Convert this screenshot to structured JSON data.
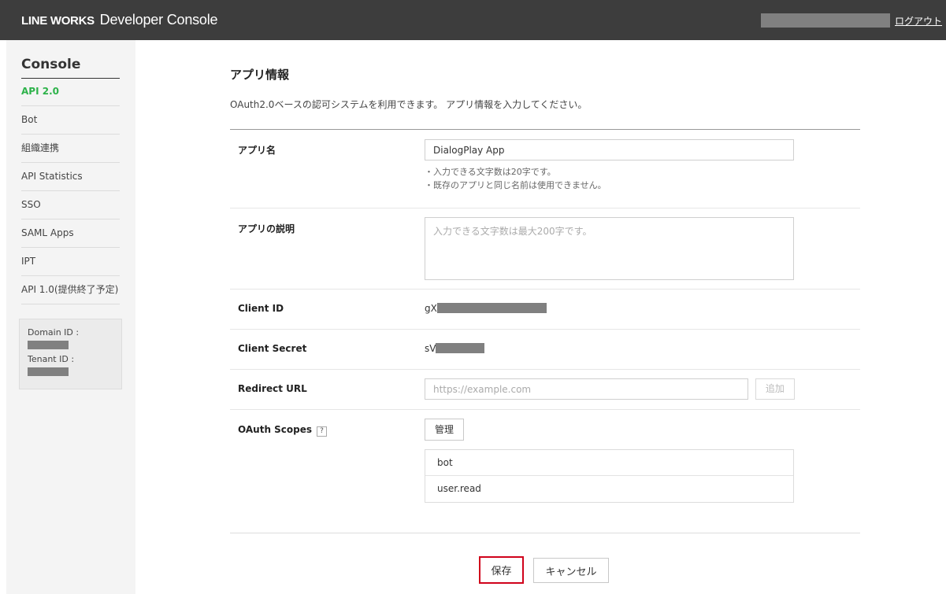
{
  "header": {
    "brand": "LINE WORKS",
    "product": "Developer Console",
    "logout_label": "ログアウト"
  },
  "sidebar": {
    "title": "Console",
    "items": [
      {
        "label": "API 2.0",
        "active": true
      },
      {
        "label": "Bot"
      },
      {
        "label": "組織連携"
      },
      {
        "label": "API Statistics"
      },
      {
        "label": "SSO"
      },
      {
        "label": "SAML Apps"
      },
      {
        "label": "IPT"
      },
      {
        "label": "API 1.0(提供終了予定)"
      }
    ],
    "domain_id_label": "Domain ID :",
    "tenant_id_label": "Tenant ID :"
  },
  "main": {
    "title": "アプリ情報",
    "description": "OAuth2.0ベースの認可システムを利用できます。 アプリ情報を入力してください。",
    "app_name": {
      "label": "アプリ名",
      "value": "DialogPlay App",
      "hint_1": "・入力できる文字数は20字です。",
      "hint_2": "・既存のアプリと同じ名前は使用できません。"
    },
    "app_description": {
      "label": "アプリの説明",
      "placeholder": "入力できる文字数は最大200字です。"
    },
    "client_id": {
      "label": "Client ID",
      "visible_prefix": "gX"
    },
    "client_secret": {
      "label": "Client Secret",
      "visible_prefix": "sV"
    },
    "redirect_url": {
      "label": "Redirect URL",
      "placeholder": "https://example.com",
      "add_label": "追加"
    },
    "oauth_scopes": {
      "label": "OAuth Scopes",
      "help_glyph": "?",
      "manage_label": "管理",
      "scopes": [
        "bot",
        "user.read"
      ]
    },
    "save_label": "保存",
    "cancel_label": "キャンセル"
  },
  "colors": {
    "header_bg": "#3d3d3d",
    "active_nav": "#2db24a",
    "save_highlight": "#d0021b"
  }
}
